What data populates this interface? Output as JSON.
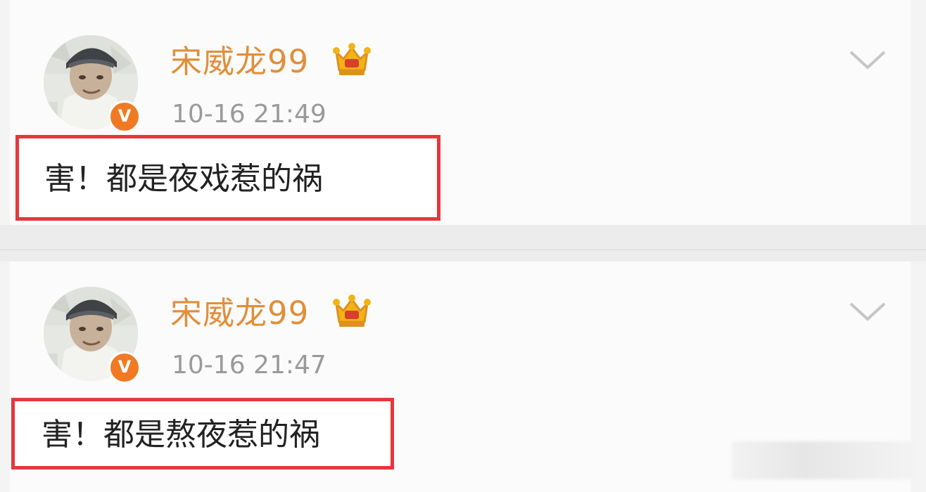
{
  "posts": [
    {
      "username": "宋威龙99",
      "timestamp": "10-16 21:49",
      "verified_badge": "V",
      "comment": "害！都是夜戏惹的祸",
      "icons": [
        "avatar",
        "verified-badge-icon",
        "crown-icon",
        "chevron-down-icon"
      ]
    },
    {
      "username": "宋威龙99",
      "timestamp": "10-16 21:47",
      "verified_badge": "V",
      "comment": "害！都是熬夜惹的祸",
      "icons": [
        "avatar",
        "verified-badge-icon",
        "crown-icon",
        "chevron-down-icon"
      ]
    }
  ],
  "colors": {
    "username": "#e08f3b",
    "timestamp": "#9a9a9a",
    "highlight_border": "#e4383c",
    "verified_badge": "#f07a23",
    "background": "#fbfbfb"
  }
}
